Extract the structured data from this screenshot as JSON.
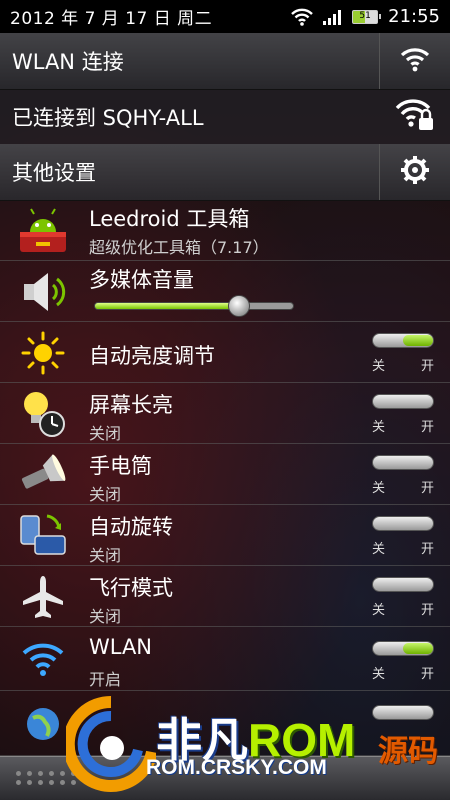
{
  "status_bar": {
    "date": "2012 年 7 月 17 日 周二",
    "battery": "51",
    "time": "21:55"
  },
  "wlan_header": {
    "label": "WLAN 连接",
    "icon": "wifi-icon"
  },
  "connection": {
    "label": "已连接到 SQHY-ALL",
    "icon": "wifi-locked-icon"
  },
  "settings_header": {
    "label": "其他设置",
    "icon": "gear-icon"
  },
  "items": [
    {
      "id": "leedroid",
      "title": "Leedroid 工具箱",
      "subtitle": "超级优化工具箱（7.17）",
      "icon": "android-toolbox-icon"
    },
    {
      "id": "media-volume",
      "title": "多媒体音量",
      "icon": "speaker-icon",
      "level": 0.72
    },
    {
      "id": "auto-brightness",
      "title": "自动亮度调节",
      "icon": "sun-icon",
      "toggle_off": "关",
      "toggle_on": "开",
      "state": true
    },
    {
      "id": "screen-on",
      "title": "屏幕长亮",
      "subtitle": "关闭",
      "icon": "bulb-clock-icon",
      "toggle_off": "关",
      "toggle_on": "开",
      "state": false
    },
    {
      "id": "flashlight",
      "title": "手电筒",
      "subtitle": "关闭",
      "icon": "flashlight-icon",
      "toggle_off": "关",
      "toggle_on": "开",
      "state": false
    },
    {
      "id": "auto-rotate",
      "title": "自动旋转",
      "subtitle": "关闭",
      "icon": "rotate-icon",
      "toggle_off": "关",
      "toggle_on": "开",
      "state": false
    },
    {
      "id": "airplane",
      "title": "飞行模式",
      "subtitle": "关闭",
      "icon": "airplane-icon",
      "toggle_off": "关",
      "toggle_on": "开",
      "state": false
    },
    {
      "id": "wlan",
      "title": "WLAN",
      "subtitle": "开启",
      "icon": "wifi-icon",
      "toggle_off": "关",
      "toggle_on": "开",
      "state": true
    }
  ],
  "watermark": {
    "brand_cn": "非凡",
    "brand_rom": "ROM",
    "url": "ROM.CRSKY.COM",
    "side": "源码"
  },
  "colors": {
    "toggle_on": "#7cc400",
    "status_bar_bg": "#000000",
    "header_bg": "#46464a"
  }
}
